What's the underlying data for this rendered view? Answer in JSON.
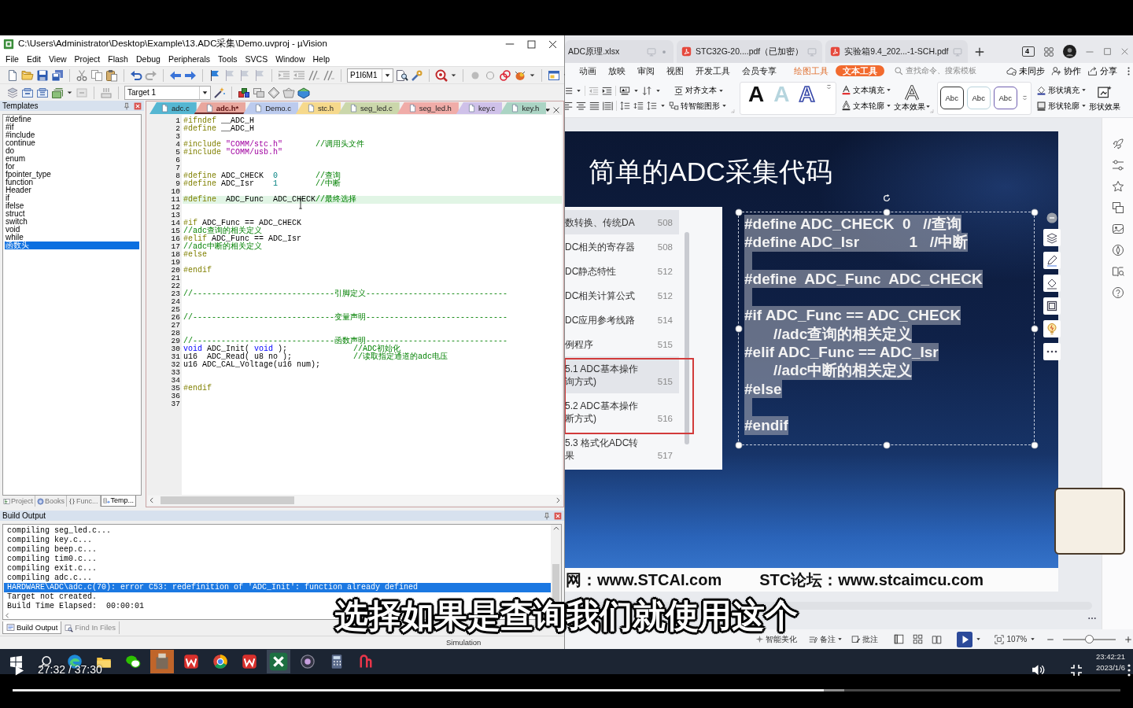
{
  "video": {
    "subtitle": "选择如果是查询我们就使用这个",
    "time": "27:32 / 37:30",
    "progress": {
      "level": 0.732
    },
    "buffer": {
      "level": 0.751
    }
  },
  "keil": {
    "title": "C:\\Users\\Administrator\\Desktop\\Example\\13.ADC采集\\Demo.uvproj - µVision",
    "menu": [
      "File",
      "Edit",
      "View",
      "Project",
      "Flash",
      "Debug",
      "Peripherals",
      "Tools",
      "SVCS",
      "Window",
      "Help"
    ],
    "device": "P1I6M1",
    "target": "Target 1",
    "templates": {
      "title": "Templates",
      "items": [
        {
          "label": "#define",
          "selected": false
        },
        {
          "label": "#if",
          "selected": false
        },
        {
          "label": "#include",
          "selected": false
        },
        {
          "label": "continue",
          "selected": false
        },
        {
          "label": "do",
          "selected": false
        },
        {
          "label": "enum",
          "selected": false
        },
        {
          "label": "for",
          "selected": false
        },
        {
          "label": "fpointer_type",
          "selected": false
        },
        {
          "label": "function",
          "selected": false
        },
        {
          "label": "Header",
          "selected": false
        },
        {
          "label": "if",
          "selected": false
        },
        {
          "label": "ifelse",
          "selected": false
        },
        {
          "label": "struct",
          "selected": false
        },
        {
          "label": "switch",
          "selected": false
        },
        {
          "label": "void",
          "selected": false
        },
        {
          "label": "while",
          "selected": false
        },
        {
          "label": "函数头",
          "selected": true
        }
      ],
      "tabs": [
        {
          "label": "Project",
          "selected": false
        },
        {
          "label": "Books",
          "selected": false
        },
        {
          "label": "Func...",
          "selected": false
        },
        {
          "label": "Temp...",
          "selected": true
        }
      ]
    },
    "editor": {
      "tabs": [
        {
          "label": "adc.c",
          "color": "#55b6d2",
          "selected": false
        },
        {
          "label": "adc.h*",
          "color": "#e9a79e",
          "selected": true
        },
        {
          "label": "Demo.c",
          "color": "#bccbee",
          "selected": false
        },
        {
          "label": "stc.h",
          "color": "#f6d98c",
          "selected": false
        },
        {
          "label": "seg_led.c",
          "color": "#cbd7ab",
          "selected": false
        },
        {
          "label": "seg_led.h",
          "color": "#f0aca8",
          "selected": false
        },
        {
          "label": "key.c",
          "color": "#cfc1e9",
          "selected": false
        },
        {
          "label": "key.h",
          "color": "#abd4c4",
          "selected": false
        }
      ],
      "lines": [
        {
          "number": "1",
          "highlighted": false,
          "segments": [
            {
              "kind": "directive",
              "text": "#ifndef"
            },
            {
              "kind": "plain",
              "text": " __ADC_H"
            }
          ]
        },
        {
          "number": "2",
          "highlighted": false,
          "segments": [
            {
              "kind": "directive",
              "text": "#define"
            },
            {
              "kind": "plain",
              "text": " __ADC_H"
            }
          ]
        },
        {
          "number": "3",
          "highlighted": false
        },
        {
          "number": "4",
          "highlighted": false,
          "segments": [
            {
              "kind": "directive",
              "text": "#include"
            },
            {
              "kind": "string",
              "text": " \"COMM/stc.h\""
            },
            {
              "kind": "comment",
              "text": "       //调用头文件"
            }
          ]
        },
        {
          "number": "5",
          "highlighted": false,
          "segments": [
            {
              "kind": "directive",
              "text": "#include"
            },
            {
              "kind": "string",
              "text": " \"COMM/usb.h\""
            }
          ]
        },
        {
          "number": "6",
          "highlighted": false
        },
        {
          "number": "7",
          "highlighted": false
        },
        {
          "number": "8",
          "highlighted": false,
          "segments": [
            {
              "kind": "directive",
              "text": "#define"
            },
            {
              "kind": "plain",
              "text": " ADC_CHECK  "
            },
            {
              "kind": "number",
              "text": "0"
            },
            {
              "kind": "comment",
              "text": "        //查询"
            }
          ]
        },
        {
          "number": "9",
          "highlighted": false,
          "segments": [
            {
              "kind": "directive",
              "text": "#define"
            },
            {
              "kind": "plain",
              "text": " ADC_Isr    "
            },
            {
              "kind": "number",
              "text": "1"
            },
            {
              "kind": "comment",
              "text": "        //中断"
            }
          ]
        },
        {
          "number": "10",
          "highlighted": false
        },
        {
          "number": "11",
          "highlighted": true,
          "segments": [
            {
              "kind": "directive",
              "text": "#define"
            },
            {
              "kind": "plain",
              "text": "  ADC_Func  ADC_CHECK"
            },
            {
              "kind": "comment",
              "text": "//最终选择"
            }
          ]
        },
        {
          "number": "12",
          "highlighted": false
        },
        {
          "number": "13",
          "highlighted": false
        },
        {
          "number": "14",
          "highlighted": false,
          "segments": [
            {
              "kind": "directive",
              "text": "#if"
            },
            {
              "kind": "plain",
              "text": " ADC_Func == ADC_CHECK"
            }
          ]
        },
        {
          "number": "15",
          "highlighted": false,
          "segments": [
            {
              "kind": "comment",
              "text": "//adc查询的相关定义"
            }
          ]
        },
        {
          "number": "16",
          "highlighted": false,
          "segments": [
            {
              "kind": "directive",
              "text": "#elif"
            },
            {
              "kind": "plain",
              "text": " ADC_Func == ADC_Isr"
            }
          ]
        },
        {
          "number": "17",
          "highlighted": false,
          "segments": [
            {
              "kind": "comment",
              "text": "//adc中断的相关定义"
            }
          ]
        },
        {
          "number": "18",
          "highlighted": false,
          "segments": [
            {
              "kind": "directive",
              "text": "#else"
            }
          ]
        },
        {
          "number": "19",
          "highlighted": false
        },
        {
          "number": "20",
          "highlighted": false,
          "segments": [
            {
              "kind": "directive",
              "text": "#endif"
            }
          ]
        },
        {
          "number": "21",
          "highlighted": false
        },
        {
          "number": "22",
          "highlighted": false
        },
        {
          "number": "23",
          "highlighted": false,
          "segments": [
            {
              "kind": "comment",
              "text": "//------------------------------引脚定义------------------------------"
            }
          ]
        },
        {
          "number": "24",
          "highlighted": false
        },
        {
          "number": "25",
          "highlighted": false
        },
        {
          "number": "26",
          "highlighted": false,
          "segments": [
            {
              "kind": "comment",
              "text": "//------------------------------变量声明------------------------------"
            }
          ]
        },
        {
          "number": "27",
          "highlighted": false
        },
        {
          "number": "28",
          "highlighted": false
        },
        {
          "number": "29",
          "highlighted": false,
          "segments": [
            {
              "kind": "comment",
              "text": "//------------------------------函数声明------------------------------"
            }
          ]
        },
        {
          "number": "30",
          "highlighted": false,
          "segments": [
            {
              "kind": "keyword",
              "text": "void"
            },
            {
              "kind": "plain",
              "text": " ADC_Init( "
            },
            {
              "kind": "keyword",
              "text": "void"
            },
            {
              "kind": "plain",
              "text": " );              "
            },
            {
              "kind": "comment",
              "text": "//ADC初始化"
            }
          ]
        },
        {
          "number": "31",
          "highlighted": false,
          "segments": [
            {
              "kind": "plain",
              "text": "u16  ADC_Read( u8 no );             "
            },
            {
              "kind": "comment",
              "text": "//读取指定通道的adc电压"
            }
          ]
        },
        {
          "number": "32",
          "highlighted": false,
          "segments": [
            {
              "kind": "plain",
              "text": "u16 ADC_CAL_Voltage(u16 num);"
            }
          ]
        },
        {
          "number": "33",
          "highlighted": false
        },
        {
          "number": "34",
          "highlighted": false
        },
        {
          "number": "35",
          "highlighted": false,
          "segments": [
            {
              "kind": "directive",
              "text": "#endif"
            }
          ]
        },
        {
          "number": "36",
          "highlighted": false
        },
        {
          "number": "37",
          "highlighted": false
        }
      ]
    },
    "build": {
      "title": "Build Output",
      "lines": [
        {
          "text": "compiling seg_led.c...",
          "selected": false
        },
        {
          "text": "compiling key.c...",
          "selected": false
        },
        {
          "text": "compiling beep.c...",
          "selected": false
        },
        {
          "text": "compiling tim0.c...",
          "selected": false
        },
        {
          "text": "compiling exit.c...",
          "selected": false
        },
        {
          "text": "compiling adc.c...",
          "selected": false
        },
        {
          "text": "HARDWARE\\ADC\\adc.c(70): error C53: redefinition of 'ADC_Init': function already defined",
          "selected": true
        },
        {
          "text": "Target not created.",
          "selected": false
        },
        {
          "text": "Build Time Elapsed:  00:00:01",
          "selected": false
        }
      ],
      "tabs": [
        {
          "label": "Build Output",
          "selected": true
        },
        {
          "label": "Find In Files",
          "selected": false
        }
      ]
    },
    "status": "Simulation"
  },
  "wps": {
    "doc_tabs": [
      {
        "label": "ADC原理.xlsx",
        "kind": "partial"
      },
      {
        "label": "STC32G-20....pdf（已加密）",
        "kind": "pdf"
      },
      {
        "label": "实验箱9.4_202...-1-SCH.pdf",
        "kind": "pdf"
      }
    ],
    "window_count": "4",
    "ribbon_tabs": [
      {
        "label": "动画",
        "kind": "main",
        "selected": false
      },
      {
        "label": "放映",
        "kind": "main",
        "selected": false
      },
      {
        "label": "审阅",
        "kind": "main",
        "selected": false
      },
      {
        "label": "视图",
        "kind": "main",
        "selected": false
      },
      {
        "label": "开发工具",
        "kind": "main",
        "selected": false
      },
      {
        "label": "会员专享",
        "kind": "main",
        "selected": false
      },
      {
        "label": "绘图工具",
        "kind": "context",
        "selected": false
      },
      {
        "label": "文本工具",
        "kind": "context",
        "selected": true
      }
    ],
    "search": {
      "placeholder": "查找命令、搜索模板"
    },
    "actions": [
      "未同步",
      "协作",
      "分享"
    ],
    "ribbon": {
      "align_text": "对齐文本",
      "smart_shape": "转智能图形",
      "text_styles": [
        {
          "text": "A",
          "kind": "solid"
        },
        {
          "text": "A",
          "kind": "light"
        },
        {
          "text": "A",
          "kind": "outline"
        }
      ],
      "text_fill": "文本填充",
      "text_outline": "文本轮廓",
      "text_effect": "文本效果",
      "shape_styles": [
        {
          "text": "Abc",
          "color": "#333333"
        },
        {
          "text": "Abc",
          "color": "#b9d3dc"
        },
        {
          "text": "Abc",
          "color": "#6f5fb0"
        }
      ],
      "shape_fill": "形状填充",
      "shape_outline": "形状轮廓",
      "shape_effect": "形状效果"
    },
    "slide": {
      "title": "简单的ADC采集代码",
      "toc": [
        {
          "lines": [
            "数转换、传统DA"
          ],
          "page": "508",
          "highlighted": true
        },
        {
          "lines": [
            "DC相关的寄存器"
          ],
          "page": "508",
          "highlighted": false
        },
        {
          "lines": [
            "DC静态特性"
          ],
          "page": "512",
          "highlighted": false
        },
        {
          "lines": [
            "DC相关计算公式"
          ],
          "page": "512",
          "highlighted": false
        },
        {
          "lines": [
            "DC应用参考线路"
          ],
          "page": "514",
          "highlighted": false
        },
        {
          "lines": [
            "例程序"
          ],
          "page": "515",
          "highlighted": false
        },
        {
          "lines": [
            "5.1 ADC基本操作",
            "询方式)"
          ],
          "page": "515",
          "highlighted": true
        },
        {
          "lines": [
            "5.2 ADC基本操作",
            "断方式)"
          ],
          "page": "516",
          "highlighted": false
        },
        {
          "lines": [
            "5.3 格式化ADC转",
            "果"
          ],
          "page": "517",
          "highlighted": false
        }
      ],
      "code_box": {
        "text_selected": true,
        "lines": [
          {
            "kind": "code",
            "text": "#define ADC_CHECK  0   //查询"
          },
          {
            "kind": "code",
            "text": "#define ADC_Isr            1   //中断"
          },
          {
            "kind": "blank"
          },
          {
            "kind": "code",
            "text": "#define  ADC_Func  ADC_CHECK"
          },
          {
            "kind": "blank"
          },
          {
            "kind": "code",
            "text": "#if ADC_Func == ADC_CHECK"
          },
          {
            "kind": "code",
            "text": "       //adc查询的相关定义"
          },
          {
            "kind": "code",
            "text": "#elif ADC_Func == ADC_Isr"
          },
          {
            "kind": "code",
            "text": "       //adc中断的相关定义"
          },
          {
            "kind": "code",
            "text": "#else"
          },
          {
            "kind": "blank"
          },
          {
            "kind": "code",
            "text": "#endif"
          }
        ]
      },
      "footer": [
        "网：www.STCAI.com",
        "STC论坛：www.stcaimcu.com"
      ]
    },
    "status_bar": {
      "beautify": "智能美化",
      "notes": "备注",
      "comments": "批注",
      "zoom": "107%",
      "zoom_slider": {
        "level": 0.49
      }
    }
  },
  "taskbar": {
    "clock": "23:42:21",
    "date": "2023/1/6"
  }
}
